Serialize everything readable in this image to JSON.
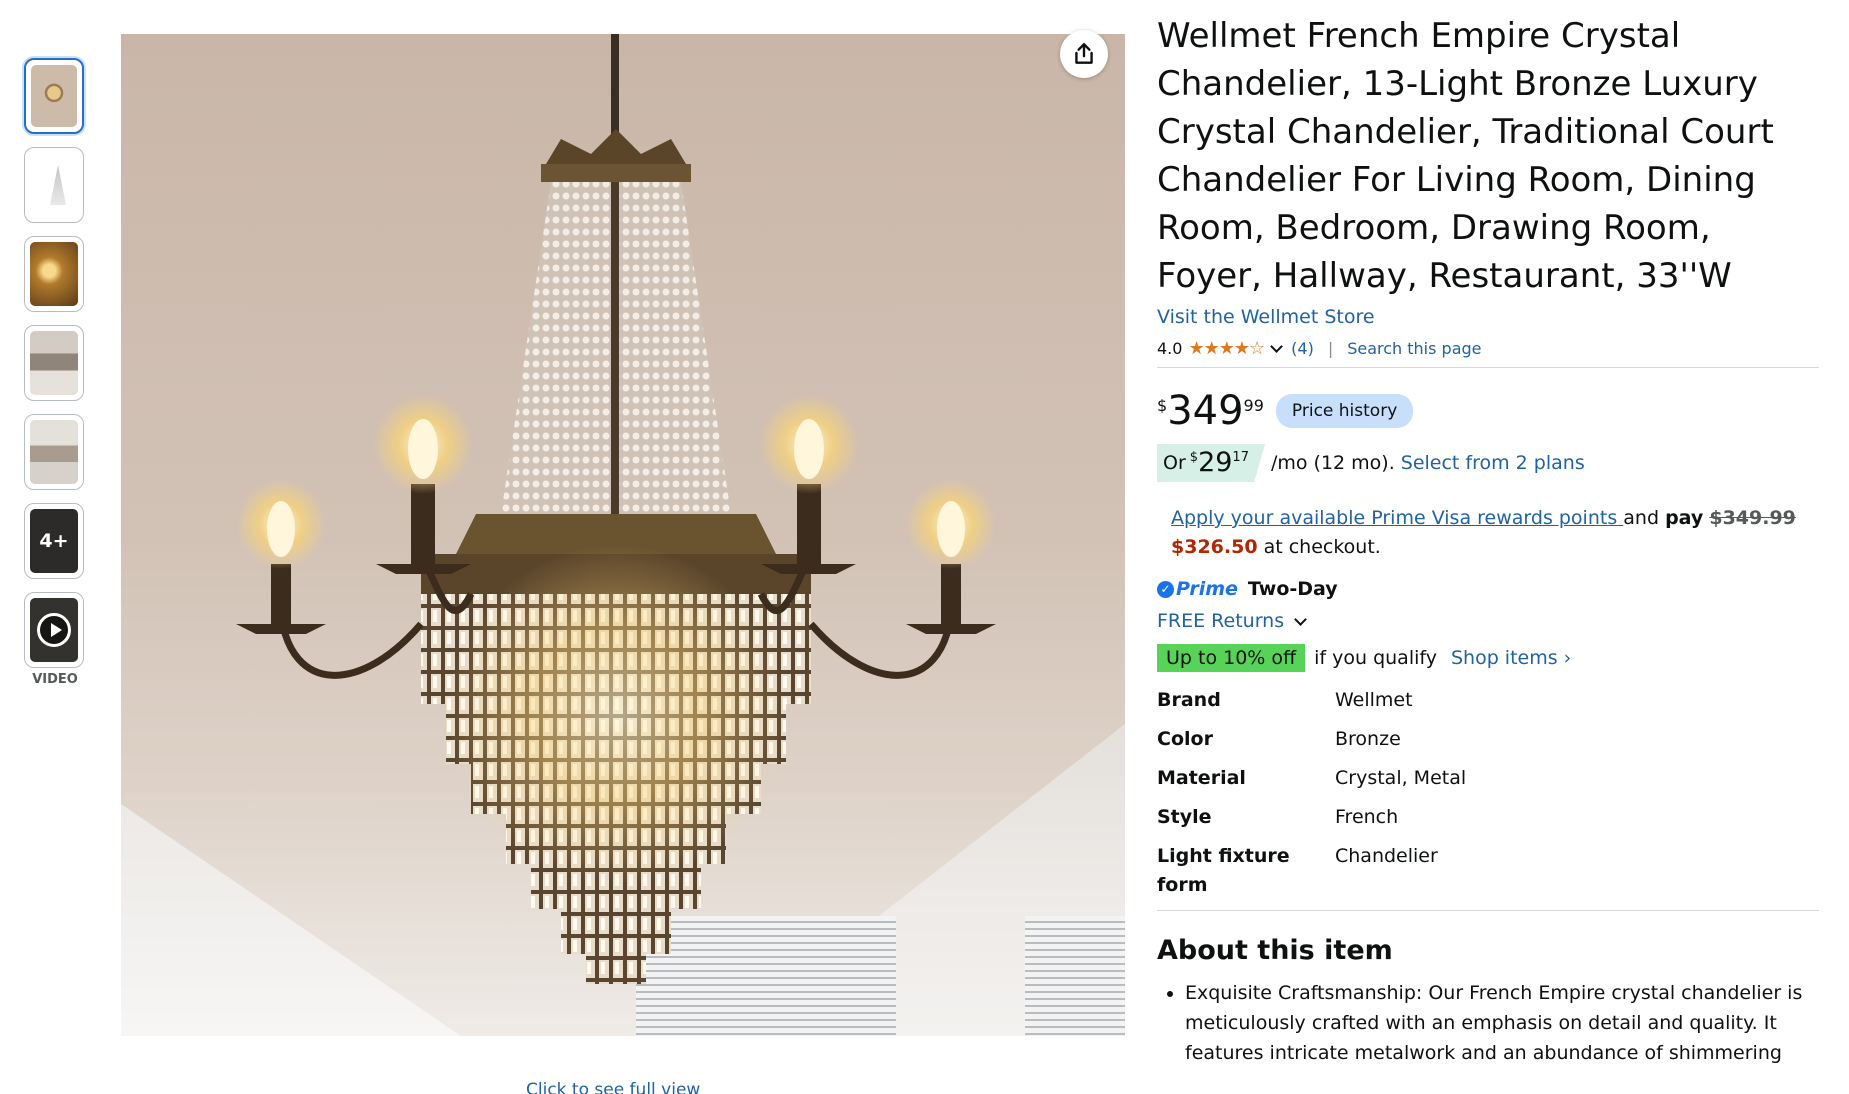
{
  "gallery": {
    "more_label": "4+",
    "video_label": "VIDEO",
    "click_full_view": "Click to see full view"
  },
  "product": {
    "title": "Wellmet French Empire Crystal Chandelier, 13-Light Bronze Luxury Crystal Chandelier, Traditional Court Chandelier For Living Room, Dining Room, Bedroom, Drawing Room, Foyer, Hallway, Restaurant, 33''W",
    "store_link": "Visit the Wellmet Store",
    "rating": "4.0",
    "stars": "★★★★☆",
    "rating_count": "(4)",
    "search_page": "Search this page"
  },
  "price": {
    "symbol": "$",
    "whole": "349",
    "fraction": "99",
    "history_button": "Price history"
  },
  "installment": {
    "prefix": "Or",
    "symbol": "$",
    "whole": "29",
    "fraction": "17",
    "suffix": "/mo (12 mo).",
    "plans_link": "Select from 2 plans"
  },
  "prime_visa": {
    "link": "Apply your available Prime Visa rewards points ",
    "and": "and",
    "pay": "pay",
    "original": "$349.99",
    "new_price": "$326.50",
    "suffix": "at checkout."
  },
  "delivery": {
    "check": "✓",
    "prime": "Prime",
    "two_day": "Two-Day",
    "returns": "FREE Returns",
    "deal_badge": "Up to 10% off",
    "deal_text": "if you qualify",
    "shop_items": "Shop items ›"
  },
  "specs": [
    {
      "key": "Brand",
      "value": "Wellmet"
    },
    {
      "key": "Color",
      "value": "Bronze"
    },
    {
      "key": "Material",
      "value": "Crystal, Metal"
    },
    {
      "key": "Style",
      "value": "French"
    },
    {
      "key": "Light fixture form",
      "value": "Chandelier"
    }
  ],
  "about": {
    "title": "About this item",
    "bullet_1": "Exquisite Craftsmanship: Our French Empire crystal chandelier is meticulously crafted with an emphasis on detail and quality. It features intricate metalwork and an abundance of shimmering"
  }
}
